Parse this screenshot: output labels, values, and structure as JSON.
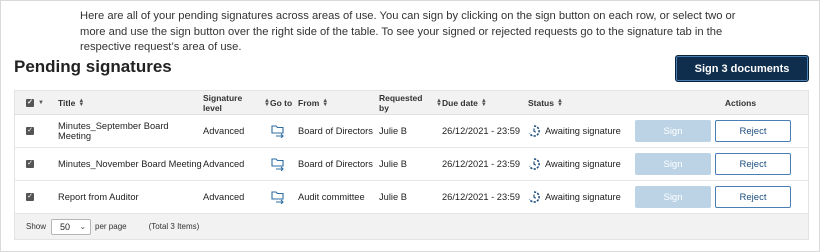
{
  "intro_text": "Here are all of your pending signatures across areas of use. You can sign by clicking on the sign button on each row, or select two or more and use the sign button over the right side of the table. To see your signed or rejected requests go to the signature tab in the respective request’s area of use.",
  "page_title": "Pending signatures",
  "sign_selected_label": "Sign 3 documents",
  "columns": {
    "title": "Title",
    "signature_level": "Signature level",
    "go_to": "Go to",
    "from": "From",
    "requested_by": "Requested by",
    "due_date": "Due date",
    "status": "Status",
    "actions": "Actions"
  },
  "rows": [
    {
      "checked": true,
      "title": "Minutes_September Board Meeting",
      "signature_level": "Advanced",
      "from": "Board of Directors",
      "requested_by": "Julie B",
      "due_date": "26/12/2021 - 23:59",
      "status": "Awaiting signature",
      "sign_label": "Sign",
      "reject_label": "Reject"
    },
    {
      "checked": true,
      "title": "Minutes_November Board Meeting",
      "signature_level": "Advanced",
      "from": "Board of Directors",
      "requested_by": "Julie B",
      "due_date": "26/12/2021 - 23:59",
      "status": "Awaiting signature",
      "sign_label": "Sign",
      "reject_label": "Reject"
    },
    {
      "checked": true,
      "title": "Report from Auditor",
      "signature_level": "Advanced",
      "from": "Audit committee",
      "requested_by": "Julie B",
      "due_date": "26/12/2021 - 23:59",
      "status": "Awaiting signature",
      "sign_label": "Sign",
      "reject_label": "Reject"
    }
  ],
  "footer": {
    "show_label": "Show",
    "page_size": "50",
    "per_page_label": "per page",
    "total_label": "(Total 3 Items)"
  },
  "colors": {
    "primary": "#0f2d4d",
    "sign_disabled": "#bcd3e6",
    "reject_border": "#4a7fb5",
    "header_bg": "#f2f2f2"
  },
  "icons": {
    "go_to": "folder-arrow-icon",
    "status": "pending-clock-icon",
    "select_all": "checkbox-checked-icon",
    "select_caret": "chevron-down-icon"
  }
}
